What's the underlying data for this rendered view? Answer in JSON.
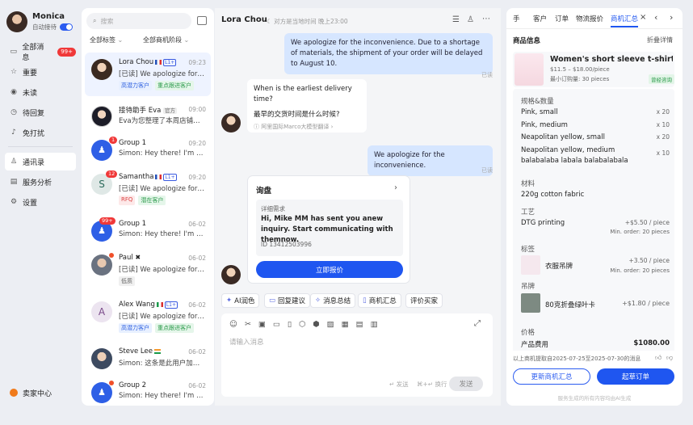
{
  "profile": {
    "name": "Monica",
    "auto_reply_label": "自动接待"
  },
  "nav": {
    "items": [
      {
        "label": "全部消息",
        "badge": "99+"
      },
      {
        "label": "重要"
      },
      {
        "label": "未读"
      },
      {
        "label": "待回复"
      },
      {
        "label": "免打扰"
      },
      {
        "label": "通讯录"
      },
      {
        "label": "服务分析"
      },
      {
        "label": "设置"
      }
    ],
    "seller_center": "卖家中心"
  },
  "list": {
    "search_placeholder": "搜索",
    "filter_tags": "全部标签",
    "filter_stage": "全部商机阶段",
    "conversations": [
      {
        "name": "Lora Chou",
        "level": "L1+",
        "time": "09:23",
        "msg": "[已读] We apologize for t...",
        "tags": [
          "高潜力客户",
          "重点跟进客户"
        ]
      },
      {
        "name": "接待助手 Eva",
        "official": "官方",
        "time": "09:00",
        "msg": "Eva为您整理了本周店铺与..."
      },
      {
        "name": "Group 1",
        "time": "09:20",
        "msg": "Simon: Hey there! I'm her..."
      },
      {
        "name": "Samantha",
        "level": "L1+",
        "badge": "12",
        "time": "09:20",
        "msg": "[已读] We apologize for t...",
        "tags": [
          "RFQ",
          "潜在客户"
        ]
      },
      {
        "name": "Group 1",
        "badge": "99+",
        "time": "06-02",
        "msg": "Simon: Hey there! I'm her..."
      },
      {
        "name": "Paul",
        "time": "06-02",
        "msg": "[已读] We apologize for t...",
        "tags": [
          "低质"
        ]
      },
      {
        "name": "Alex Wang",
        "level": "L1+",
        "time": "06-02",
        "msg": "[已读] We apologize for t...",
        "tags": [
          "高潜力客户",
          "重点跟进客户"
        ]
      },
      {
        "name": "Steve Lee",
        "time": "06-02",
        "msg": "Simon: 这条是此用户加入黑名..."
      },
      {
        "name": "Group 2",
        "time": "06-02",
        "msg": "Simon: Hey there! I'm her..."
      }
    ]
  },
  "chat": {
    "contact_name": "Lora Chou",
    "status": "对方是当地时间 晚上23:00",
    "msg1": "We apologize for the inconvenience. Due to a shortage of materials, the shipment of your order will be delayed to August 10.",
    "read_label": "已读",
    "msg2_en": "When is the earliest delivery time?",
    "msg2_cn": "最早的交货时间是什么时候?",
    "msg2_note": "阿里国际Marco大模型翻译",
    "msg3": "We apologize for the inconvenience.",
    "card": {
      "title": "询盘",
      "subtitle": "详细需求",
      "body": "Hi, Mike MM has sent you anew inquiry. Start communicating with themnow.",
      "id": "ID 13412503996",
      "button": "立即报价"
    },
    "tools": [
      "AI润色",
      "回复建议",
      "消息总结",
      "商机汇总",
      "评价买家"
    ],
    "input_placeholder": "请输入消息",
    "send_hint": "发送",
    "newline_hint": "换行",
    "send_button": "发送"
  },
  "panel": {
    "tabs": [
      "手",
      "客户",
      "订单",
      "物流报价",
      "商机汇总"
    ],
    "active_tab": "商机汇总",
    "product_info": "商品信息",
    "collapse": "折叠详情",
    "product": {
      "title": "Women's short sleeve t-shirt pl...",
      "price": "$11.5 – $18.00/piece",
      "moq": "最小订购量: 30 pieces",
      "badge": "曾经咨询"
    },
    "spec_label": "规格&数量",
    "specs": [
      {
        "name": "Pink, small",
        "qty": "x 20"
      },
      {
        "name": "Pink, medium",
        "qty": "x 10"
      },
      {
        "name": "Neapolitan yellow, small",
        "qty": "x 20"
      },
      {
        "name": "Neapolitan yellow, medium balabalaba labala balabalabala",
        "qty": "x 10"
      }
    ],
    "material_label": "材料",
    "material": "220g cotton fabric",
    "process_label": "工艺",
    "process": "DTG printing",
    "process_price": "+$5.50 / piece",
    "process_min": "Min. order: 20 pieces",
    "label_label": "标签",
    "label_item": "衣服吊牌",
    "label_price": "+3.50 / piece",
    "label_min": "Min. order: 20 pieces",
    "hangtag_label": "吊牌",
    "hangtag_item": "80克折叠绿叶卡",
    "hangtag_price": "+$1.80 / piece",
    "price_label": "价格",
    "product_cost_label": "产品费用",
    "product_cost": "$1080.00",
    "summary_note": "以上商机提取自2025-07-25至2025-07-30的消息",
    "update_button": "更新商机汇总",
    "draft_button": "起草订单",
    "footer_note": "服务生成的所有内容均由AI生成"
  },
  "colors": {
    "accent": "#1f56f0",
    "badge": "#f03838"
  }
}
